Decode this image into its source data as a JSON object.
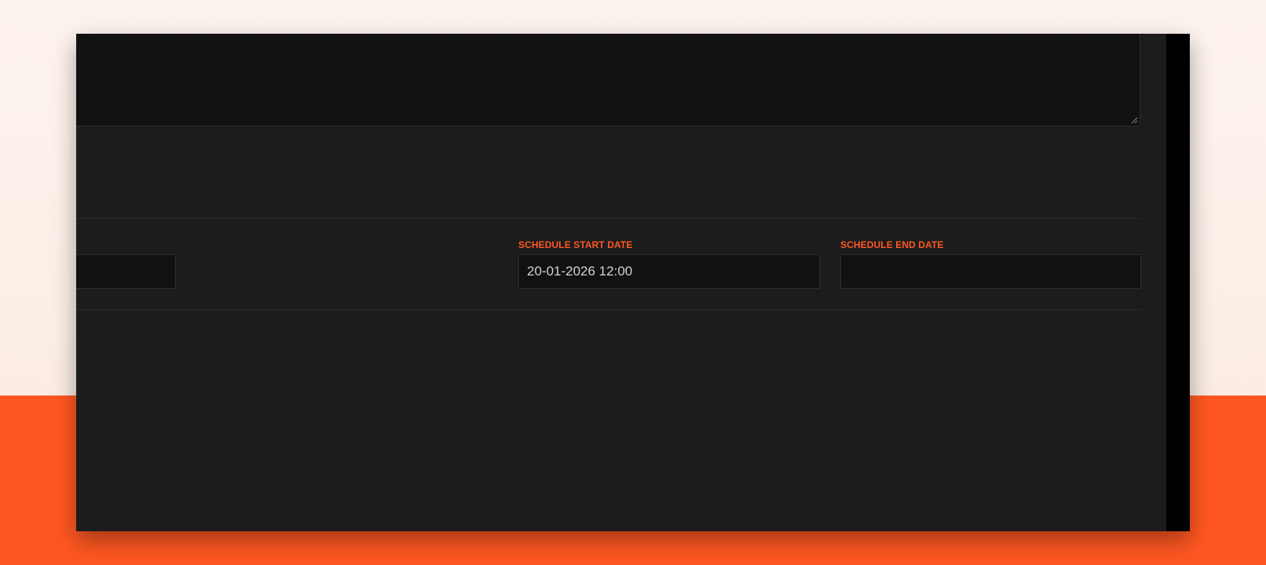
{
  "form": {
    "schedule_start_date": {
      "label": "SCHEDULE START DATE",
      "value": "20-01-2026 12:00"
    },
    "schedule_end_date": {
      "label": "SCHEDULE END DATE",
      "value": ""
    },
    "partial_field": {
      "value": ""
    },
    "textarea": {
      "value": ""
    }
  },
  "colors": {
    "accent": "#ff5722",
    "panel": "#1c1c1c",
    "input": "#111111"
  }
}
